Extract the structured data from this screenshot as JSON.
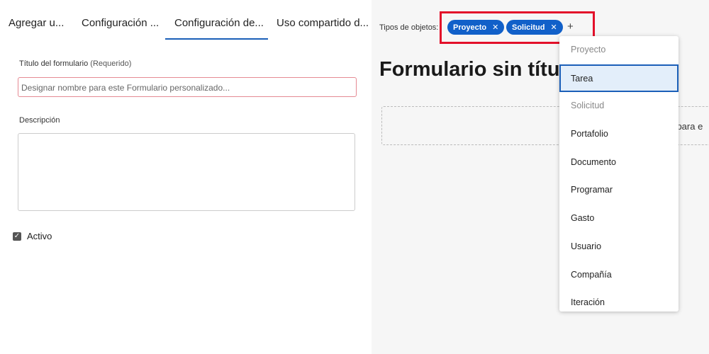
{
  "tabs": [
    {
      "label": "Agregar u..."
    },
    {
      "label": "Configuración ..."
    },
    {
      "label": "Configuración de...",
      "active": true
    },
    {
      "label": "Uso compartido d..."
    }
  ],
  "form": {
    "title_label": "Título del formulario",
    "required": "(Requerido)",
    "title_placeholder": "Designar nombre para este Formulario personalizado...",
    "description_label": "Descripción",
    "active_label": "Activo",
    "active_checked": true
  },
  "object_types": {
    "label": "Tipos de objetos:",
    "selected": [
      "Proyecto",
      "Solicitud"
    ],
    "remove_glyph": "✕",
    "add_glyph": "+"
  },
  "preview": {
    "title": "Formulario sin título",
    "drop_text": "uí para e"
  },
  "menu": {
    "items": [
      {
        "label": "Proyecto",
        "disabled": true
      },
      {
        "label": "Tarea",
        "highlighted": true
      },
      {
        "label": "Solicitud",
        "disabled": true
      },
      {
        "label": "Portafolio"
      },
      {
        "label": "Documento"
      },
      {
        "label": "Programar"
      },
      {
        "label": "Gasto"
      },
      {
        "label": "Usuario"
      },
      {
        "label": "Compañía"
      },
      {
        "label": "Iteración"
      }
    ]
  },
  "colors": {
    "accent": "#1160c9",
    "highlight_box": "#e3102a"
  }
}
